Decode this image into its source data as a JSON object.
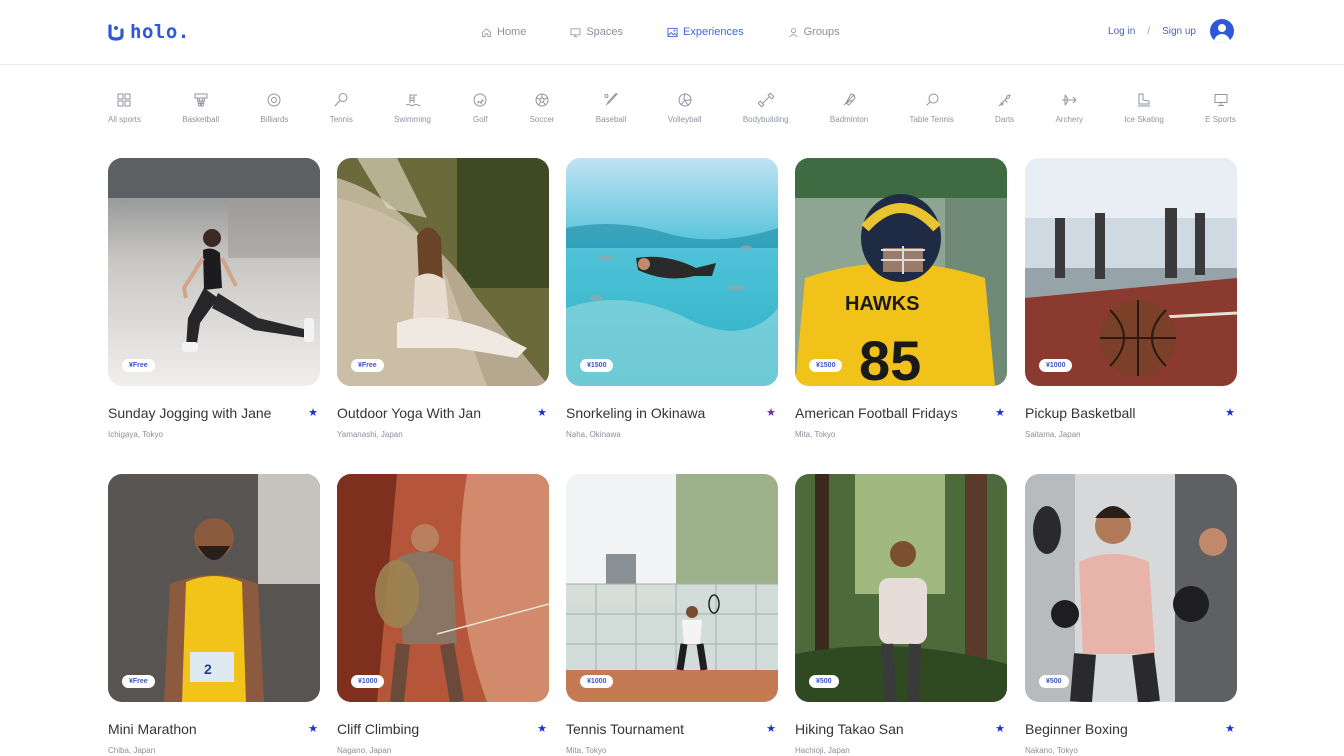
{
  "brand": {
    "name": "holo."
  },
  "nav": [
    {
      "label": "Home",
      "icon": "home-icon",
      "active": false
    },
    {
      "label": "Spaces",
      "icon": "monitor-icon",
      "active": false
    },
    {
      "label": "Experiences",
      "icon": "image-icon",
      "active": true
    },
    {
      "label": "Groups",
      "icon": "user-icon",
      "active": false
    }
  ],
  "auth": {
    "login": "Log in",
    "separator": "/",
    "signup": "Sign up"
  },
  "sports": [
    {
      "label": "All sports",
      "icon": "grid-icon"
    },
    {
      "label": "Basketball",
      "icon": "basketball-hoop-icon"
    },
    {
      "label": "Billiards",
      "icon": "billiards-ball-icon"
    },
    {
      "label": "Tennis",
      "icon": "tennis-racket-icon"
    },
    {
      "label": "Swimming",
      "icon": "swimming-icon"
    },
    {
      "label": "Golf",
      "icon": "golf-ball-icon"
    },
    {
      "label": "Soccer",
      "icon": "soccer-ball-icon"
    },
    {
      "label": "Baseball",
      "icon": "baseball-bat-icon"
    },
    {
      "label": "Volleyball",
      "icon": "volleyball-icon"
    },
    {
      "label": "Bodybuilding",
      "icon": "dumbbell-icon"
    },
    {
      "label": "Badminton",
      "icon": "shuttlecock-icon"
    },
    {
      "label": "Table Tennis",
      "icon": "ping-pong-icon"
    },
    {
      "label": "Darts",
      "icon": "dart-icon"
    },
    {
      "label": "Archery",
      "icon": "bow-arrow-icon"
    },
    {
      "label": "Ice Skating",
      "icon": "ice-skate-icon"
    },
    {
      "label": "E Sports",
      "icon": "computer-icon"
    }
  ],
  "experiences": [
    {
      "title": "Sunday Jogging with Jane",
      "location": "Ichigaya, Tokyo",
      "price": "¥Free",
      "star": "★",
      "star_color": "#1f2fd0"
    },
    {
      "title": "Outdoor Yoga With Jan",
      "location": "Yamanashi, Japan",
      "price": "¥Free",
      "star": "★",
      "star_color": "#1f2fd0"
    },
    {
      "title": "Snorkeling in Okinawa",
      "location": "Naha, Okinawa",
      "price": "¥1500",
      "star": "★",
      "star_color": "#6e2bb5"
    },
    {
      "title": "American Football Fridays",
      "location": "Mita, Tokyo",
      "price": "¥1500",
      "star": "★",
      "star_color": "#1f2fd0"
    },
    {
      "title": "Pickup Basketball",
      "location": "Saitama, Japan",
      "price": "¥1000",
      "star": "★",
      "star_color": "#1f2fd0"
    },
    {
      "title": "Mini Marathon",
      "location": "Chiba, Japan",
      "price": "¥Free",
      "star": "★",
      "star_color": "#1f2fd0"
    },
    {
      "title": "Cliff Climbing",
      "location": "Nagano, Japan",
      "price": "¥1000",
      "star": "★",
      "star_color": "#1f2fd0"
    },
    {
      "title": "Tennis Tournament",
      "location": "Mita, Tokyo",
      "price": "¥1000",
      "star": "★",
      "star_color": "#1f2fd0"
    },
    {
      "title": "Hiking Takao San",
      "location": "Hachioji, Japan",
      "price": "¥500",
      "star": "★",
      "star_color": "#1f2fd0"
    },
    {
      "title": "Beginner Boxing",
      "location": "Nakano, Tokyo",
      "price": "¥500",
      "star": "★",
      "star_color": "#1f2fd0"
    }
  ]
}
